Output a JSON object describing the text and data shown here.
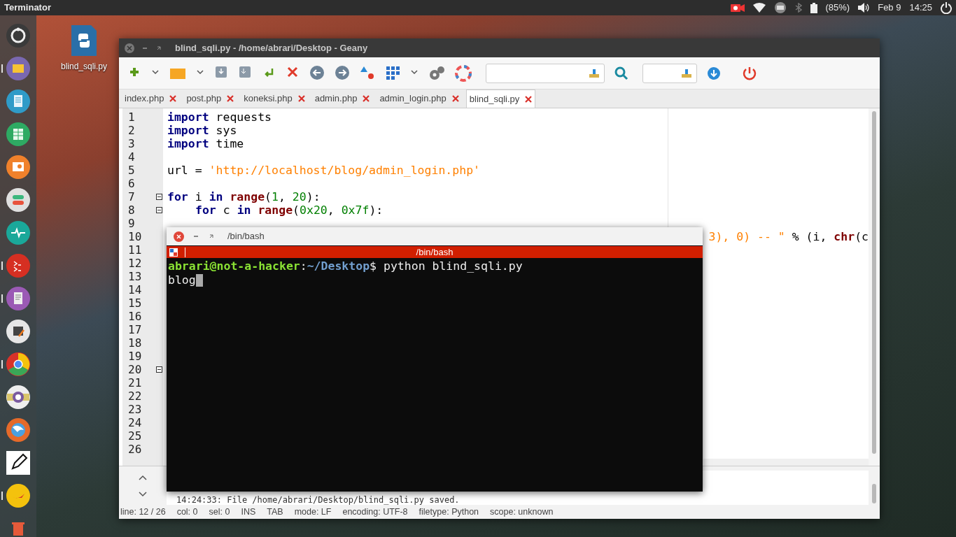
{
  "top_panel": {
    "app_name": "Terminator",
    "battery": "(85%)",
    "date": "Feb 9",
    "time": "14:25"
  },
  "dock": [
    {
      "running": false
    },
    {
      "running": true
    },
    {
      "running": false
    },
    {
      "running": false
    },
    {
      "running": false
    },
    {
      "running": false
    },
    {
      "running": false
    },
    {
      "running": true
    },
    {
      "running": true
    },
    {
      "running": false
    },
    {
      "running": true
    },
    {
      "running": false
    },
    {
      "running": false
    },
    {
      "running": false
    },
    {
      "running": true
    },
    {
      "running": false
    }
  ],
  "desktop_icon": {
    "label": "blind_sqli.py"
  },
  "editor_window": {
    "title": "blind_sqli.py - /home/abrari/Desktop - Geany",
    "tabs": [
      {
        "label": "index.php",
        "selected": false
      },
      {
        "label": "post.php",
        "selected": false
      },
      {
        "label": "koneksi.php",
        "selected": false
      },
      {
        "label": "admin.php",
        "selected": false
      },
      {
        "label": "admin_login.php",
        "selected": false
      },
      {
        "label": "blind_sqli.py",
        "selected": true
      }
    ],
    "lines": [
      {
        "n": "1",
        "fold": false,
        "kind": "code",
        "tokens": [
          {
            "kind": "kw",
            "text": "import"
          },
          {
            "kind": "plain",
            "text": " requests"
          }
        ]
      },
      {
        "n": "2",
        "fold": false,
        "kind": "code",
        "tokens": [
          {
            "kind": "kw",
            "text": "import"
          },
          {
            "kind": "plain",
            "text": " sys"
          }
        ]
      },
      {
        "n": "3",
        "fold": false,
        "kind": "code",
        "tokens": [
          {
            "kind": "kw",
            "text": "import"
          },
          {
            "kind": "plain",
            "text": " time"
          }
        ]
      },
      {
        "n": "4",
        "fold": false,
        "kind": "code"
      },
      {
        "n": "5",
        "fold": false,
        "kind": "code",
        "tokens": [
          {
            "kind": "plain",
            "text": "url = "
          },
          {
            "kind": "str",
            "text": "'http://localhost/blog/admin_login.php'"
          }
        ]
      },
      {
        "n": "6",
        "fold": false,
        "kind": "code"
      },
      {
        "n": "7",
        "fold": true,
        "kind": "code",
        "tokens": [
          {
            "kind": "kw",
            "text": "for"
          },
          {
            "kind": "plain",
            "text": " i "
          },
          {
            "kind": "kw",
            "text": "in "
          },
          {
            "kind": "fn",
            "text": "range"
          },
          {
            "kind": "plain",
            "text": "("
          },
          {
            "kind": "num",
            "text": "1"
          },
          {
            "kind": "plain",
            "text": ", "
          },
          {
            "kind": "num",
            "text": "20"
          },
          {
            "kind": "plain",
            "text": "):"
          }
        ]
      },
      {
        "n": "8",
        "fold": true,
        "kind": "indented",
        "tokens": [
          {
            "kind": "kw",
            "text": "for"
          },
          {
            "kind": "plain",
            "text": " c "
          },
          {
            "kind": "kw",
            "text": "in "
          },
          {
            "kind": "fn",
            "text": "range"
          },
          {
            "kind": "plain",
            "text": "("
          },
          {
            "kind": "num",
            "text": "0x20"
          },
          {
            "kind": "plain",
            "text": ", "
          },
          {
            "kind": "num",
            "text": "0x7f"
          },
          {
            "kind": "plain",
            "text": "):"
          }
        ]
      },
      {
        "n": "9",
        "fold": false,
        "kind": "code"
      },
      {
        "n": "10",
        "fold": false,
        "kind": "tail",
        "tokens": [
          {
            "kind": "str",
            "text": "3), 0) -- \""
          },
          {
            "kind": "plain",
            "text": " % (i, "
          },
          {
            "kind": "fn",
            "text": "chr"
          },
          {
            "kind": "plain",
            "text": "(c"
          }
        ]
      },
      {
        "n": "11",
        "fold": false,
        "kind": "code"
      },
      {
        "n": "12",
        "fold": false,
        "kind": "code"
      },
      {
        "n": "13",
        "fold": false,
        "kind": "code"
      },
      {
        "n": "14",
        "fold": false,
        "kind": "code"
      },
      {
        "n": "15",
        "fold": false,
        "kind": "code"
      },
      {
        "n": "16",
        "fold": false,
        "kind": "code"
      },
      {
        "n": "17",
        "fold": false,
        "kind": "code"
      },
      {
        "n": "18",
        "fold": false,
        "kind": "code"
      },
      {
        "n": "19",
        "fold": false,
        "kind": "code"
      },
      {
        "n": "20",
        "fold": true,
        "kind": "code"
      },
      {
        "n": "21",
        "fold": false,
        "kind": "code"
      },
      {
        "n": "22",
        "fold": false,
        "kind": "code"
      },
      {
        "n": "23",
        "fold": false,
        "kind": "code"
      },
      {
        "n": "24",
        "fold": false,
        "kind": "code"
      },
      {
        "n": "25",
        "fold": false,
        "kind": "code"
      },
      {
        "n": "26",
        "fold": false,
        "kind": "code"
      }
    ],
    "message": "14:24:33: File /home/abrari/Desktop/blind_sqli.py saved.",
    "status_bar": [
      "line: 12 / 26",
      "col: 0",
      "sel: 0",
      "INS",
      "TAB",
      "mode: LF",
      "encoding: UTF-8",
      "filetype: Python",
      "scope: unknown"
    ]
  },
  "terminal_window": {
    "title": "/bin/bash",
    "tab_title": "/bin/bash",
    "prompt": {
      "user_host": "abrari@not-a-hacker",
      "separator": ":",
      "path": "~/Desktop",
      "dollar": "$",
      "command": " python blind_sqli.py"
    },
    "output": "blog"
  }
}
